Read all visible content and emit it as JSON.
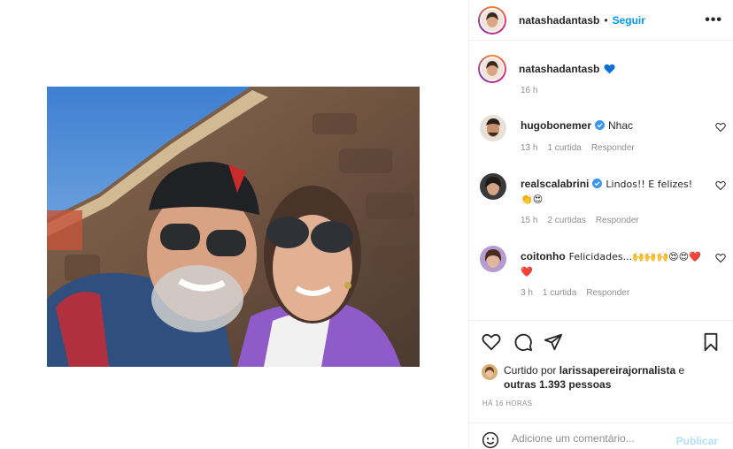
{
  "post": {
    "author": "natashadantasb",
    "follow_label": "Seguir",
    "separator": "•",
    "more_label": "•••",
    "caption_emoji": "💙",
    "caption_time": "16 h"
  },
  "comments": [
    {
      "user": "hugobonemer",
      "verified": true,
      "text": "Nhac",
      "time": "13 h",
      "likes": "1 curtida",
      "reply": "Responder"
    },
    {
      "user": "realscalabrini",
      "verified": true,
      "text": "Lindos!! E felizes! 👏😍",
      "time": "15 h",
      "likes": "2 curtidas",
      "reply": "Responder"
    },
    {
      "user": "coitonho",
      "verified": false,
      "text": "Felicidades...🙌🙌🙌😍😍❤️❤️",
      "time": "3 h",
      "likes": "1 curtida",
      "reply": "Responder"
    }
  ],
  "likes": {
    "prefix": "Curtido por",
    "user": "larissapereirajornalista",
    "joiner": "e",
    "others": "outras 1.393 pessoas"
  },
  "posted_ago": "HÁ 16 HORAS",
  "comment_box": {
    "placeholder": "Adicione um comentário...",
    "publish_label": "Publicar"
  },
  "colors": {
    "accent": "#0095f6",
    "publish_disabled": "#b2dffc",
    "muted": "#8e8e8e",
    "verified": "#3897f0",
    "heart_blue": "#0b6fd8"
  },
  "icons": [
    "more-options-icon",
    "blue-heart-icon",
    "verified-badge-icon",
    "like-heart-icon",
    "comment-bubble-icon",
    "share-paper-plane-icon",
    "bookmark-icon",
    "emoji-smile-icon"
  ]
}
